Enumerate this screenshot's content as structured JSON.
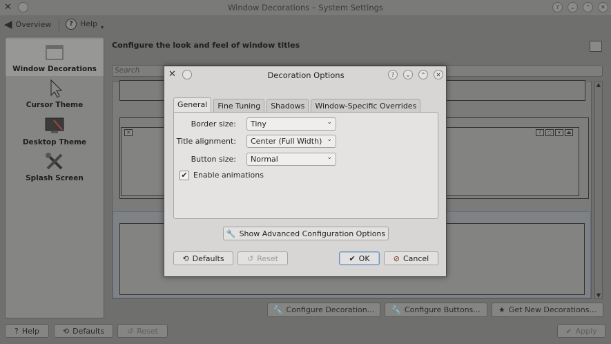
{
  "window": {
    "title": "Window Decorations – System Settings"
  },
  "toolbar": {
    "overview_label": "Overview",
    "help_label": "Help"
  },
  "sidebar": {
    "items": [
      {
        "label": "Window Decorations",
        "icon": "window-decorations-icon",
        "selected": true
      },
      {
        "label": "Cursor Theme",
        "icon": "cursor-icon"
      },
      {
        "label": "Desktop Theme",
        "icon": "desktop-theme-icon"
      },
      {
        "label": "Splash Screen",
        "icon": "splash-screen-icon"
      }
    ]
  },
  "main": {
    "heading": "Configure the look and feel of window titles",
    "search_placeholder": "Search",
    "buttons": {
      "configure_decoration": "Configure Decoration...",
      "configure_buttons": "Configure Buttons...",
      "get_new": "Get New Decorations..."
    }
  },
  "footer": {
    "help": "Help",
    "defaults": "Defaults",
    "reset": "Reset",
    "apply": "Apply"
  },
  "dialog": {
    "title": "Decoration Options",
    "tabs": [
      "General",
      "Fine Tuning",
      "Shadows",
      "Window-Specific Overrides"
    ],
    "active_tab": "General",
    "fields": {
      "border_size_label": "Border size:",
      "border_size_value": "Tiny",
      "title_alignment_label": "Title alignment:",
      "title_alignment_value": "Center (Full Width)",
      "button_size_label": "Button size:",
      "button_size_value": "Normal",
      "enable_animations_label": "Enable animations",
      "enable_animations_checked": true
    },
    "advanced_button": "Show Advanced Configuration Options",
    "defaults_button": "Defaults",
    "reset_button": "Reset",
    "ok_button": "OK",
    "cancel_button": "Cancel"
  },
  "colors": {
    "dim_background": "#6f6f6e",
    "dialog_background": "#d7d6d5",
    "focus_accent": "#6c8fb8"
  }
}
